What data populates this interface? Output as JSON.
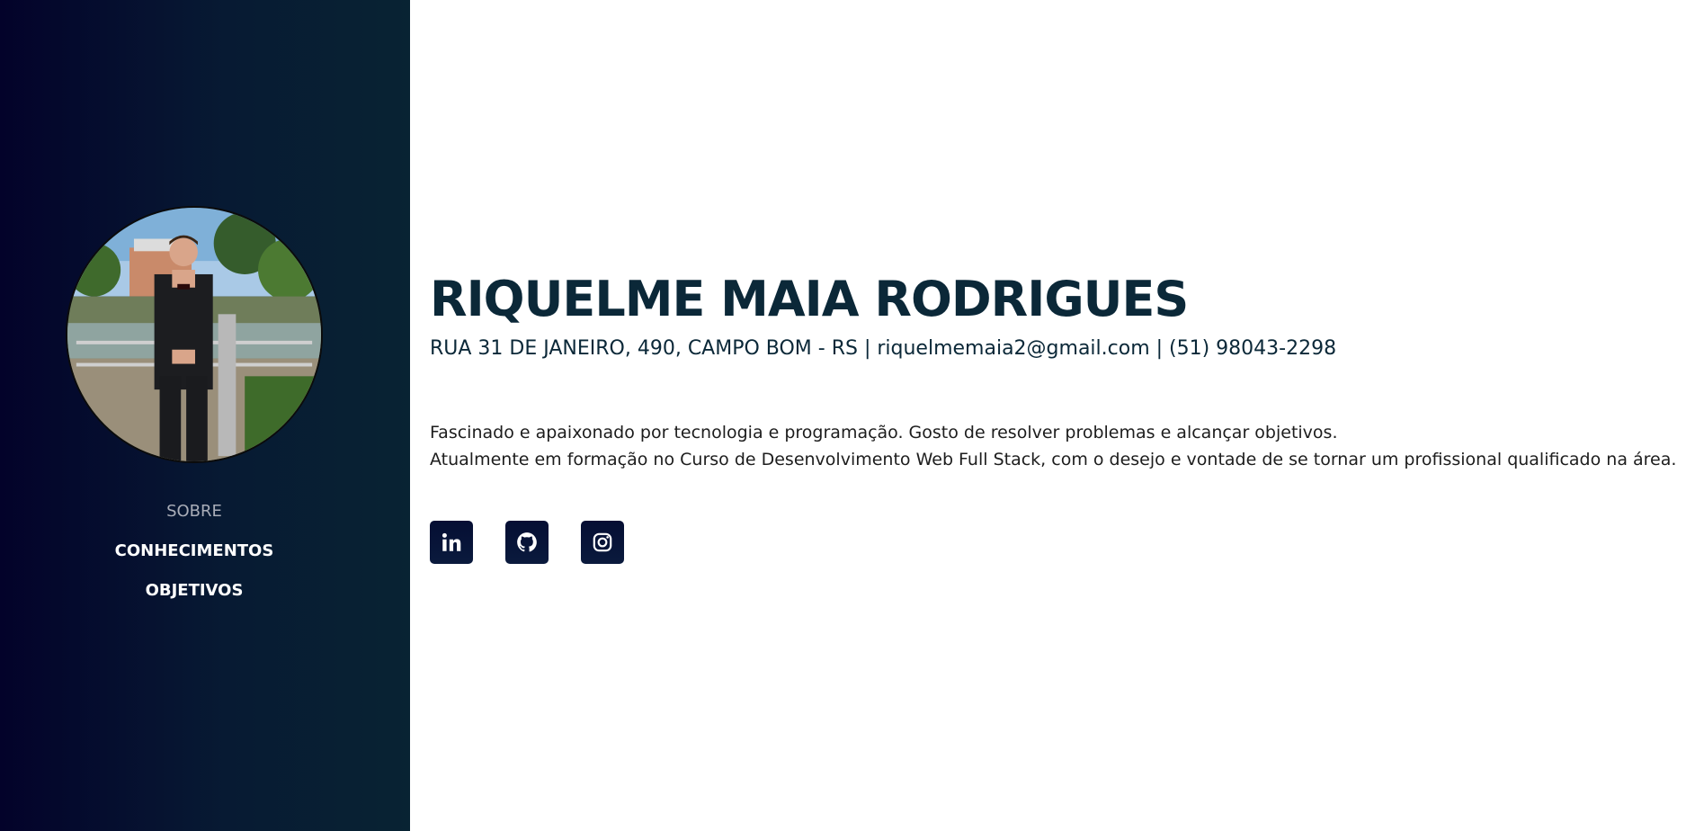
{
  "sidebar": {
    "nav": [
      {
        "label": "SOBRE",
        "active": true
      },
      {
        "label": "CONHECIMENTOS",
        "active": false
      },
      {
        "label": "OBJETIVOS",
        "active": false
      }
    ],
    "avatar_icon": "profile-photo"
  },
  "main": {
    "name": "RIQUELME MAIA RODRIGUES",
    "contact": "RUA 31 DE JANEIRO, 490, CAMPO BOM - RS | riquelmemaia2@gmail.com | (51) 98043-2298",
    "about": [
      "Fascinado e apaixonado por tecnologia e programação. Gosto de resolver problemas e alcançar objetivos.",
      "Atualmente em formação no Curso de Desenvolvimento Web Full Stack, com o desejo e vontade de se tornar um profissional qualificado na área."
    ],
    "social": [
      {
        "icon": "linkedin-icon"
      },
      {
        "icon": "github-icon"
      },
      {
        "icon": "instagram-icon"
      }
    ]
  },
  "colors": {
    "sidebar_start": "#03022a",
    "sidebar_end": "#082333",
    "heading": "#0b2838",
    "nav_active": "#a9adb8",
    "social_bg": "#050e33"
  }
}
